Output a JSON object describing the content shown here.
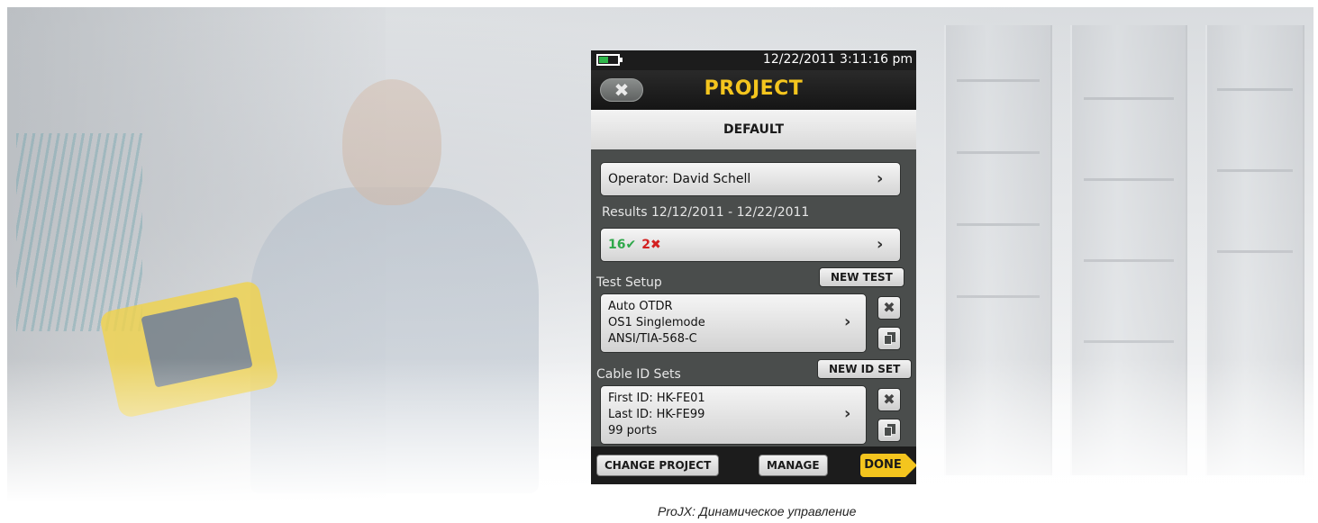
{
  "status": {
    "datetime": "12/22/2011 3:11:16 pm",
    "battery_icon": "battery-icon",
    "battery_color": "#2fb64a"
  },
  "header": {
    "title": "PROJECT",
    "title_color": "#f4c51e",
    "close_icon": "close-icon",
    "close_glyph": "✖"
  },
  "project": {
    "name": "DEFAULT"
  },
  "operator": {
    "label": "Operator: David Schell"
  },
  "results": {
    "range_label": "Results 12/12/2011 - 12/22/2011",
    "pass_count": "16",
    "pass_glyph": "✔",
    "fail_count": "2",
    "fail_glyph": "✖",
    "pass_color": "#2fa84a",
    "fail_color": "#d32020"
  },
  "test_setup": {
    "section_label": "Test Setup",
    "new_button": "NEW TEST",
    "lines": [
      "Auto OTDR",
      "OS1 Singlemode",
      "ANSI/TIA-568-C"
    ]
  },
  "cable_id": {
    "section_label": "Cable ID Sets",
    "new_button": "NEW ID SET",
    "lines": [
      "First ID: HK-FE01",
      "Last ID: HK-FE99",
      "99 ports"
    ]
  },
  "icons": {
    "delete_glyph": "✖",
    "chevron_glyph": "›"
  },
  "bottom_bar": {
    "change_project": "CHANGE PROJECT",
    "manage": "MANAGE",
    "done": "DONE"
  },
  "caption": "ProJX: Динамическое управление"
}
